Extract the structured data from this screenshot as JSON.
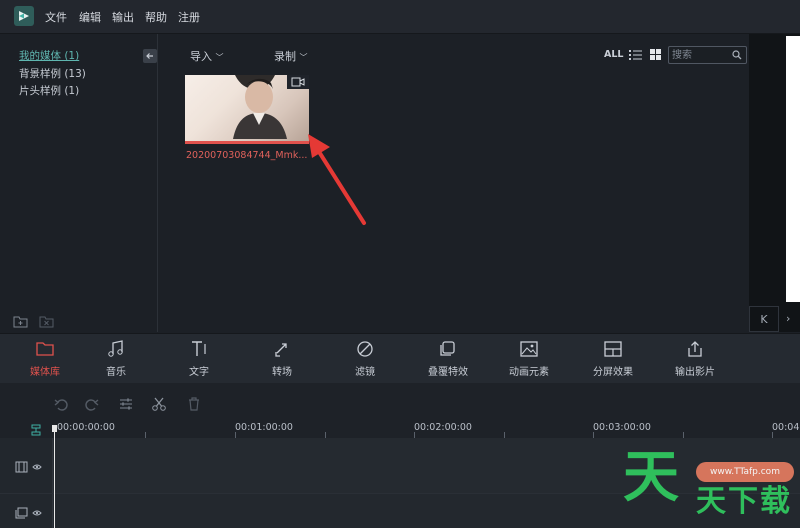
{
  "menu": [
    "文件",
    "编辑",
    "输出",
    "帮助",
    "注册"
  ],
  "library": {
    "items": [
      "我的媒体 (1)",
      "背景样例 (13)",
      "片头样例 (1)"
    ],
    "active_index": 0
  },
  "media_toolbar": {
    "import_label": "导入",
    "record_label": "录制",
    "all_label": "ALL",
    "search_placeholder": "搜索"
  },
  "media_items": [
    {
      "label": "20200703084744_Mmk..."
    }
  ],
  "preview": {
    "k_label": "K"
  },
  "tools": [
    {
      "label": "媒体库",
      "icon": "folder-icon",
      "active": true
    },
    {
      "label": "音乐",
      "icon": "music-icon"
    },
    {
      "label": "文字",
      "icon": "text-icon"
    },
    {
      "label": "转场",
      "icon": "transition-icon"
    },
    {
      "label": "滤镜",
      "icon": "filter-icon"
    },
    {
      "label": "叠覆特效",
      "icon": "overlay-icon"
    },
    {
      "label": "动画元素",
      "icon": "image-icon"
    },
    {
      "label": "分屏效果",
      "icon": "split-screen-icon"
    },
    {
      "label": "输出影片",
      "icon": "export-icon"
    }
  ],
  "timeline": {
    "times": [
      "00:00:00:00",
      "00:01:00:00",
      "00:02:00:00",
      "00:03:00:00",
      "00:04"
    ]
  },
  "watermark": {
    "url": "www.TTafp.com",
    "big": "天",
    "small": "天下载"
  },
  "colors": {
    "accent": "#e0524d",
    "library_active": "#5fb6b0",
    "watermark_green": "#2fbf5c"
  }
}
